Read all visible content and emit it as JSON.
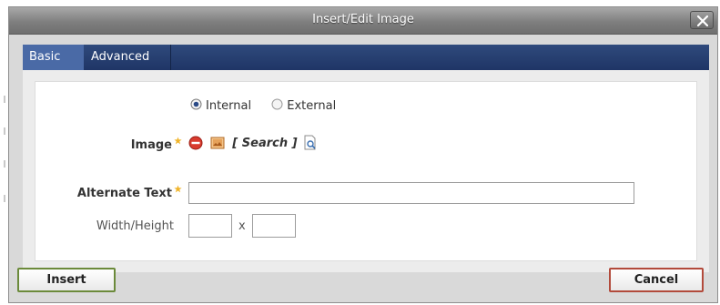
{
  "dialog": {
    "title": "Insert/Edit Image"
  },
  "tabs": [
    {
      "label": "Basic",
      "active": true
    },
    {
      "label": "Advanced",
      "active": false
    }
  ],
  "source": {
    "options": [
      "Internal",
      "External"
    ],
    "selected": "Internal"
  },
  "image": {
    "label": "Image",
    "search_open": "[",
    "search_text": "Search",
    "search_close": "]"
  },
  "alternate_text": {
    "label": "Alternate Text",
    "value": ""
  },
  "dimensions": {
    "label": "Width/Height",
    "separator": "x",
    "width": "",
    "height": ""
  },
  "buttons": {
    "insert": "Insert",
    "cancel": "Cancel"
  },
  "colors": {
    "tab_bar": "#1f3566",
    "active_tab": "#4a6aa6",
    "required_star": "#f0b429",
    "insert_border": "#6b8a3a",
    "cancel_border": "#b24a3b"
  },
  "icons": [
    "close-icon",
    "radio-selected-icon",
    "radio-unselected-icon",
    "required-star-icon",
    "remove-icon",
    "image-thumbnail-icon",
    "search-document-icon"
  ]
}
